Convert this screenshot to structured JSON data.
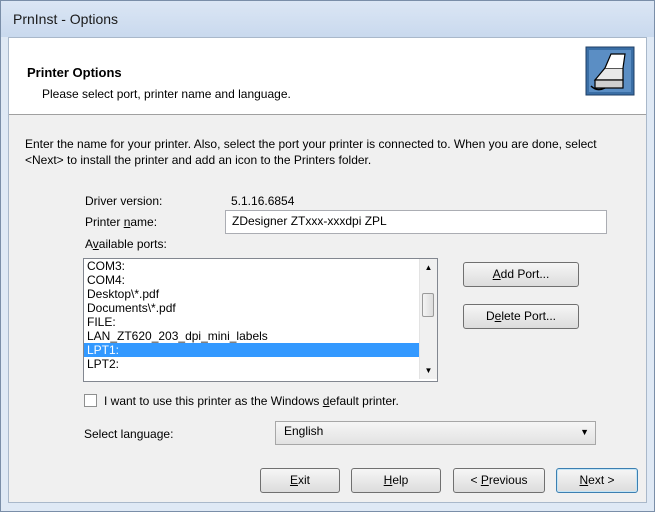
{
  "window": {
    "title": "PrnInst - Options"
  },
  "header": {
    "title": "Printer Options",
    "subtitle": "Please select port, printer name and language.",
    "icon": "printer-wizard-icon"
  },
  "intro_text": "Enter the name for your printer. Also, select the port your printer is connected to. When you are done, select <Next> to install the printer and add an icon to the Printers folder.",
  "driver": {
    "label": "Driver version:",
    "value": "5.1.16.6854"
  },
  "printer_name": {
    "label": "Printer name:",
    "value": "ZDesigner ZTxxx-xxxdpi ZPL"
  },
  "ports": {
    "label": "Available ports:",
    "items": [
      "COM3:",
      "COM4:",
      "Desktop\\*.pdf",
      "Documents\\*.pdf",
      "FILE:",
      "LAN_ZT620_203_dpi_mini_labels",
      "LPT1:",
      "LPT2:"
    ],
    "selected": "LPT1:"
  },
  "buttons": {
    "add_port": "Add Port...",
    "delete_port": "Delete Port...",
    "exit": "Exit",
    "help": "Help",
    "previous": "< Previous",
    "next": "Next >"
  },
  "default_printer": {
    "label": "I want to use this printer as the Windows default printer.",
    "checked": false
  },
  "language": {
    "label": "Select language:",
    "value": "English"
  }
}
